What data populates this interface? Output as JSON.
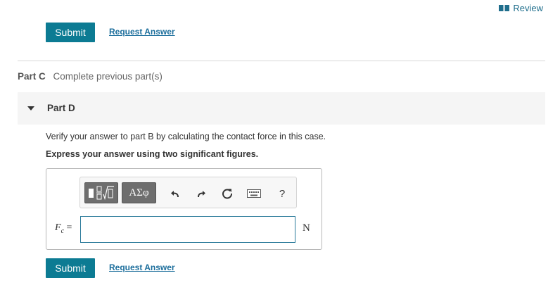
{
  "header": {
    "review_label": "Review"
  },
  "top_actions": {
    "submit_label": "Submit",
    "request_label": "Request Answer"
  },
  "part_c": {
    "label": "Part C",
    "status": "Complete previous part(s)"
  },
  "part_d": {
    "label": "Part D",
    "question": "Verify your answer to part B by calculating the contact force in this case.",
    "instruction": "Express your answer using two significant figures.",
    "toolbar": {
      "templates_icon": "templates-icon",
      "symbols_label": "ΑΣφ",
      "undo_icon": "undo-icon",
      "redo_icon": "redo-icon",
      "reset_icon": "reset-icon",
      "keyboard_icon": "keyboard-icon",
      "help_label": "?"
    },
    "variable": {
      "symbol": "F",
      "subscript": "c",
      "equals": "="
    },
    "answer_value": "",
    "unit": "N",
    "submit_label": "Submit",
    "request_label": "Request Answer"
  },
  "colors": {
    "accent": "#0c7b93",
    "link": "#1c6e9c",
    "header_bg": "#f5f5f5"
  }
}
